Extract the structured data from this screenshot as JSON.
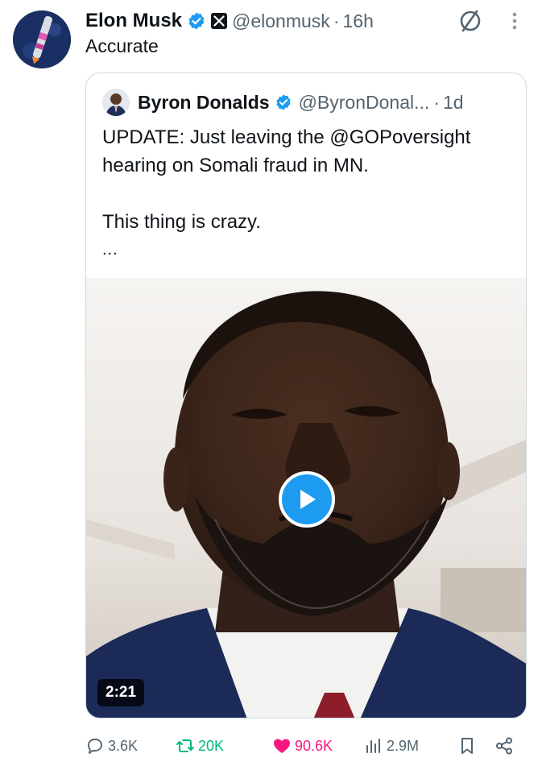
{
  "tweet": {
    "author_name": "Elon Musk",
    "handle": "@elonmusk",
    "separator": "·",
    "time": "16h",
    "text": "Accurate"
  },
  "quoted": {
    "author_name": "Byron Donalds",
    "handle": "@ByronDonal...",
    "separator": "·",
    "time": "1d",
    "text_line1": "UPDATE: Just leaving the @GOPoversight",
    "text_line2": "hearing on Somali fraud in MN.",
    "text_line3": "This thing is crazy.",
    "ellipsis": "...",
    "video_duration": "2:21"
  },
  "actions": {
    "replies": "3.6K",
    "reposts": "20K",
    "likes": "90.6K",
    "views": "2.9M"
  },
  "colors": {
    "verified_blue": "#1d9bf0",
    "repost_green": "#00ba7c",
    "like_pink": "#f91880",
    "muted_text": "#536471"
  },
  "icons": [
    "verified-badge-icon",
    "x-logo-icon",
    "grok-icon",
    "more-vertical-icon",
    "play-icon",
    "reply-icon",
    "repost-icon",
    "like-icon",
    "views-icon",
    "bookmark-icon",
    "share-icon"
  ]
}
